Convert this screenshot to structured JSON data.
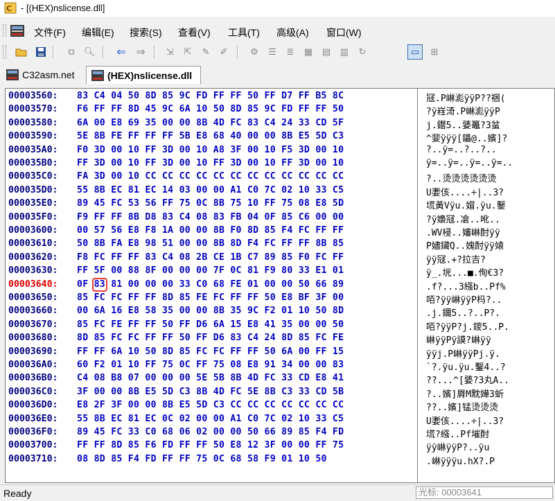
{
  "window": {
    "title": "- [(HEX)nslicense.dll]"
  },
  "menu": [
    "文件(F)",
    "编辑(E)",
    "搜索(S)",
    "查看(V)",
    "工具(T)",
    "高级(A)",
    "窗口(W)"
  ],
  "toolbar_icons": [
    "open-folder-icon",
    "save-icon",
    "copy-icon",
    "find-icon",
    "back-arrow-icon",
    "forward-arrow-icon",
    "goto-icon",
    "bookmark-icon",
    "edit-icon",
    "patch-icon",
    "settings-icon",
    "list-icon",
    "indent-icon",
    "view-a-icon",
    "view-b-icon",
    "view-c-icon",
    "refresh-icon",
    "hex-view-icon",
    "grid-view-icon"
  ],
  "tabs": [
    {
      "label": "C32asm.net",
      "active": false
    },
    {
      "label": "(HEX)nslicense.dll",
      "active": true
    }
  ],
  "hex": {
    "rows": [
      {
        "addr": "00003560:",
        "bytes": [
          "83",
          "C4",
          "04",
          "50",
          "8D",
          "85",
          "9C",
          "FD",
          "FF",
          "FF",
          "50",
          "FF",
          "D7",
          "FF",
          "B5",
          "8C"
        ],
        "ascii": "冦.P崊滮ÿÿP??祵("
      },
      {
        "addr": "00003570:",
        "bytes": [
          "F6",
          "FF",
          "FF",
          "8D",
          "45",
          "9C",
          "6A",
          "10",
          "50",
          "8D",
          "85",
          "9C",
          "FD",
          "FF",
          "FF",
          "50"
        ],
        "ascii": "?ÿ嵀渏.P崊滮ÿÿP"
      },
      {
        "addr": "00003580:",
        "bytes": [
          "6A",
          "00",
          "E8",
          "69",
          "35",
          "00",
          "00",
          "8B",
          "4D",
          "FC",
          "83",
          "C4",
          "24",
          "33",
          "CD",
          "5F"
        ],
        "ascii": "j.鑙5..婱鼉?3蚠"
      },
      {
        "addr": "00003590:",
        "bytes": [
          "5E",
          "8B",
          "FE",
          "FF",
          "FF",
          "FF",
          "5B",
          "E8",
          "68",
          "40",
          "00",
          "00",
          "8B",
          "E5",
          "5D",
          "C3"
        ],
        "ascii": "^婓ÿÿÿ[鑘@..嬪]?"
      },
      {
        "addr": "000035A0:",
        "bytes": [
          "F0",
          "3D",
          "00",
          "10",
          "FF",
          "3D",
          "00",
          "10",
          "A8",
          "3F",
          "00",
          "10",
          "F5",
          "3D",
          "00",
          "10"
        ],
        "ascii": "?..ÿ=..?..?.."
      },
      {
        "addr": "000035B0:",
        "bytes": [
          "FF",
          "3D",
          "00",
          "10",
          "FF",
          "3D",
          "00",
          "10",
          "FF",
          "3D",
          "00",
          "10",
          "FF",
          "3D",
          "00",
          "10"
        ],
        "ascii": "ÿ=..ÿ=..ÿ=..ÿ=.."
      },
      {
        "addr": "000035C0:",
        "bytes": [
          "FA",
          "3D",
          "00",
          "10",
          "CC",
          "CC",
          "CC",
          "CC",
          "CC",
          "CC",
          "CC",
          "CC",
          "CC",
          "CC",
          "CC",
          "CC"
        ],
        "ascii": "?..烫烫烫烫烫烫"
      },
      {
        "addr": "000035D0:",
        "bytes": [
          "55",
          "8B",
          "EC",
          "81",
          "EC",
          "14",
          "03",
          "00",
          "00",
          "A1",
          "C0",
          "7C",
          "02",
          "10",
          "33",
          "C5"
        ],
        "ascii": "U嬱侅....÷|..3?"
      },
      {
        "addr": "000035E0:",
        "bytes": [
          "89",
          "45",
          "FC",
          "53",
          "56",
          "FF",
          "75",
          "0C",
          "8B",
          "75",
          "10",
          "FF",
          "75",
          "08",
          "E8",
          "5D"
        ],
        "ascii": "塃黃Vÿu.媢.ÿu.鑋"
      },
      {
        "addr": "000035F0:",
        "bytes": [
          "F9",
          "FF",
          "FF",
          "8B",
          "D8",
          "83",
          "C4",
          "08",
          "83",
          "FB",
          "04",
          "0F",
          "85",
          "C6",
          "00",
          "00"
        ],
        "ascii": "?ÿ嬝冦.凔..吪.."
      },
      {
        "addr": "00003600:",
        "bytes": [
          "00",
          "57",
          "56",
          "E8",
          "F8",
          "1A",
          "00",
          "00",
          "8B",
          "F0",
          "8D",
          "85",
          "F4",
          "FC",
          "FF",
          "FF"
        ],
        "ascii": ".WV梫..嬸崊酎ÿÿ"
      },
      {
        "addr": "00003610:",
        "bytes": [
          "50",
          "8B",
          "FA",
          "E8",
          "98",
          "51",
          "00",
          "00",
          "8B",
          "8D",
          "F4",
          "FC",
          "FF",
          "FF",
          "8B",
          "85"
        ],
        "ascii": "P嬧鑶Q..媿酎ÿÿ媴"
      },
      {
        "addr": "00003620:",
        "bytes": [
          "F8",
          "FC",
          "FF",
          "FF",
          "83",
          "C4",
          "08",
          "2B",
          "CE",
          "1B",
          "C7",
          "89",
          "85",
          "F0",
          "FC",
          "FF"
        ],
        "ascii": "ÿÿ冦.+?拉吉?"
      },
      {
        "addr": "00003630:",
        "bytes": [
          "FF",
          "5F",
          "00",
          "88",
          "8F",
          "00",
          "00",
          "00",
          "7F",
          "0C",
          "81",
          "F9",
          "80",
          "33",
          "E1",
          "01"
        ],
        "ascii": "ÿ_.垙...■.侚€3?"
      },
      {
        "addr": "00003640:",
        "bytes": [
          "0F",
          "83",
          "81",
          "00",
          "00",
          "00",
          "33",
          "C0",
          "68",
          "FE",
          "01",
          "00",
          "00",
          "50",
          "66",
          "89"
        ],
        "ascii": ".f?...3繦b..Pf%",
        "current": true
      },
      {
        "addr": "00003650:",
        "bytes": [
          "85",
          "FC",
          "FC",
          "FF",
          "FF",
          "8D",
          "85",
          "FE",
          "FC",
          "FF",
          "FF",
          "50",
          "E8",
          "BF",
          "3F",
          "00"
        ],
        "ascii": "咟?ÿÿ崊ÿÿP杩?.."
      },
      {
        "addr": "00003660:",
        "bytes": [
          "00",
          "6A",
          "16",
          "E8",
          "58",
          "35",
          "00",
          "00",
          "8B",
          "35",
          "9C",
          "F2",
          "01",
          "10",
          "50",
          "8D"
        ],
        "ascii": ".j.鑈5..?..P?."
      },
      {
        "addr": "00003670:",
        "bytes": [
          "85",
          "FC",
          "FE",
          "FF",
          "FF",
          "50",
          "FF",
          "D6",
          "6A",
          "15",
          "E8",
          "41",
          "35",
          "00",
          "00",
          "50"
        ],
        "ascii": "咟?ÿÿP?j.鑁5..P."
      },
      {
        "addr": "00003680:",
        "bytes": [
          "8D",
          "85",
          "FC",
          "FC",
          "FF",
          "FF",
          "50",
          "FF",
          "D6",
          "83",
          "C4",
          "24",
          "8D",
          "85",
          "FC",
          "FE"
        ],
        "ascii": "崊ÿÿPÿ謨?崊ÿÿ"
      },
      {
        "addr": "00003690:",
        "bytes": [
          "FF",
          "FF",
          "6A",
          "10",
          "50",
          "8D",
          "85",
          "FC",
          "FC",
          "FF",
          "FF",
          "50",
          "6A",
          "00",
          "FF",
          "15"
        ],
        "ascii": "ÿÿj.P崊ÿÿPj.ÿ."
      },
      {
        "addr": "000036A0:",
        "bytes": [
          "60",
          "F2",
          "01",
          "10",
          "FF",
          "75",
          "0C",
          "FF",
          "75",
          "08",
          "E8",
          "91",
          "34",
          "00",
          "00",
          "83"
        ],
        "ascii": "`?.ÿu.ÿu.鑿4..?"
      },
      {
        "addr": "000036B0:",
        "bytes": [
          "C4",
          "08",
          "B8",
          "07",
          "00",
          "00",
          "00",
          "5E",
          "5B",
          "8B",
          "4D",
          "FC",
          "33",
          "CD",
          "E8",
          "41"
        ],
        "ascii": "??...^[婱?3丸A.."
      },
      {
        "addr": "000036C0:",
        "bytes": [
          "3F",
          "00",
          "00",
          "8B",
          "E5",
          "5D",
          "C3",
          "8B",
          "4D",
          "FC",
          "5E",
          "8B",
          "C3",
          "33",
          "CD",
          "5B"
        ],
        "ascii": "?..嬪]脣M黕嬅3蚚"
      },
      {
        "addr": "000036D0:",
        "bytes": [
          "E8",
          "2F",
          "3F",
          "00",
          "00",
          "8B",
          "E5",
          "5D",
          "C3",
          "CC",
          "CC",
          "CC",
          "CC",
          "CC",
          "CC",
          "CC"
        ],
        "ascii": "??..嬪]锰烫烫烫"
      },
      {
        "addr": "000036E0:",
        "bytes": [
          "55",
          "8B",
          "EC",
          "81",
          "EC",
          "0C",
          "02",
          "00",
          "00",
          "A1",
          "C0",
          "7C",
          "02",
          "10",
          "33",
          "C5"
        ],
        "ascii": "U嬱侅....÷|..3?"
      },
      {
        "addr": "000036F0:",
        "bytes": [
          "89",
          "45",
          "FC",
          "33",
          "C0",
          "68",
          "06",
          "02",
          "00",
          "00",
          "50",
          "66",
          "89",
          "85",
          "F4",
          "FD"
        ],
        "ascii": "塃?繦..Pf墔酎"
      },
      {
        "addr": "00003700:",
        "bytes": [
          "FF",
          "FF",
          "8D",
          "85",
          "F6",
          "FD",
          "FF",
          "FF",
          "50",
          "E8",
          "12",
          "3F",
          "00",
          "00",
          "FF",
          "75"
        ],
        "ascii": "ÿÿ崊ÿÿP?..ÿu"
      },
      {
        "addr": "00003710:",
        "bytes": [
          "08",
          "8D",
          "85",
          "F4",
          "FD",
          "FF",
          "FF",
          "75",
          "0C",
          "68",
          "58",
          "F9",
          "01",
          "10",
          "50"
        ],
        "ascii": ".崊ÿÿÿu.hX?.P"
      }
    ]
  },
  "status": {
    "left": "Ready",
    "cursor": "光标: 00003641"
  }
}
